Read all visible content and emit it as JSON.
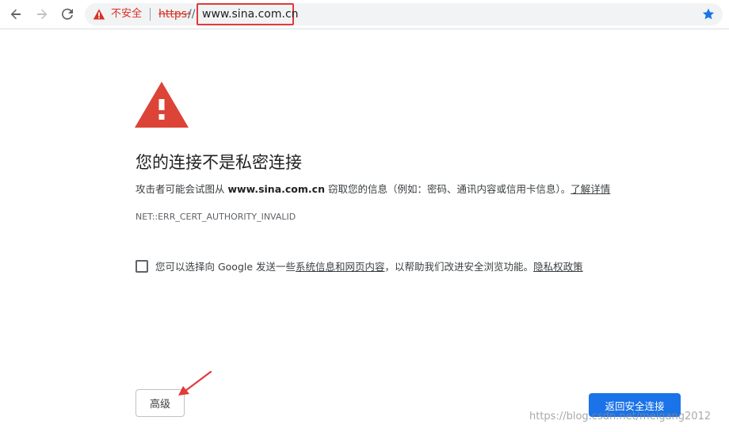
{
  "toolbar": {
    "back_icon": "back-arrow-icon",
    "forward_icon": "forward-arrow-icon",
    "reload_icon": "reload-icon",
    "omnibox": {
      "security_icon": "warning-triangle-icon",
      "security_label": "不安全",
      "url_scheme": "https:",
      "url_slashes": "//",
      "url_host": "www.sina.com.cn",
      "bookmark_icon": "star-icon"
    }
  },
  "interstitial": {
    "icon": "warning-triangle-icon",
    "heading": "您的连接不是私密连接",
    "description": {
      "prefix": "攻击者可能会试图从 ",
      "host": "www.sina.com.cn",
      "suffix": " 窃取您的信息（例如：密码、通讯内容或信用卡信息）。",
      "learn_more": "了解详情"
    },
    "error_code": "NET::ERR_CERT_AUTHORITY_INVALID",
    "opt_in": {
      "prefix": "您可以选择向 Google 发送一些",
      "link": "系统信息和网页内容",
      "middle": "，以帮助我们改进安全浏览功能。",
      "privacy_link": "隐私权政策",
      "checked": false
    },
    "advanced_button": "高级",
    "back_button": "返回安全连接"
  },
  "annotation": {
    "arrow_icon": "red-arrow-icon"
  },
  "watermark": "https://blog.csdn.net/meigang2012",
  "colors": {
    "danger": "#d93025",
    "primary": "#1a73e8",
    "warning_icon": "#db4437",
    "highlight_box": "#e03a3a"
  }
}
